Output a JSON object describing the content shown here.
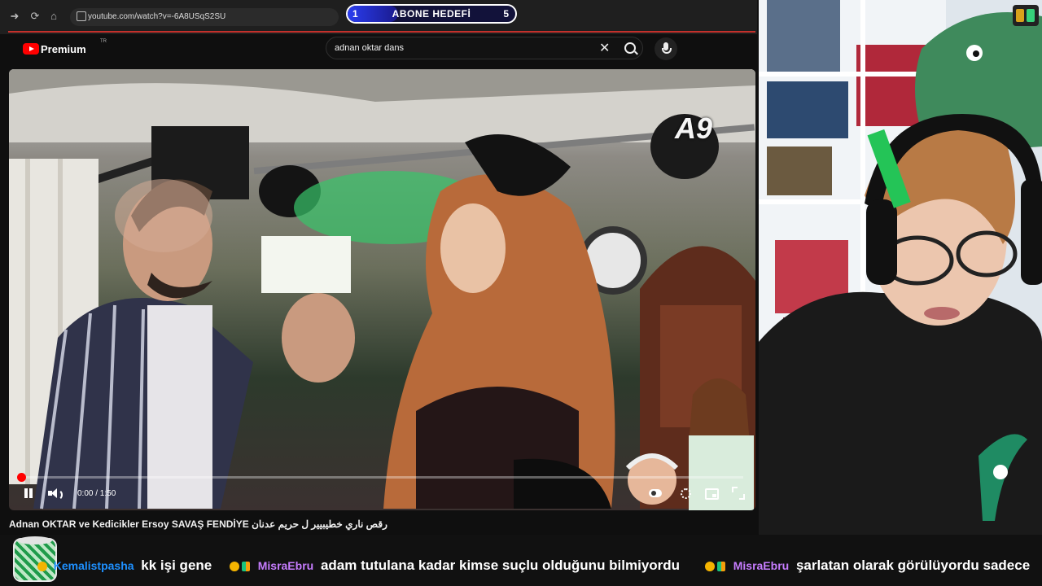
{
  "browser": {
    "url": "youtube.com/watch?v=-6A8USqS2SU",
    "nav_icons": [
      "arrow-forward-icon",
      "reload-icon",
      "home-icon",
      "site-settings-icon"
    ]
  },
  "goal_widget": {
    "title": "ABONE HEDEFİ",
    "min": "1",
    "max": "5",
    "progress_fraction": 0.1,
    "colors": {
      "fill": "#2a3df0",
      "background": "#12123a"
    }
  },
  "youtube": {
    "logo_text": "Premium",
    "logo_superscript": "TR",
    "search_query": "adnan oktar dans",
    "icons": [
      "clear-icon",
      "search-icon",
      "mic-icon"
    ],
    "brand_color": "#ff0000"
  },
  "player": {
    "watermark": "A9",
    "time_display": "0:00 / 1:50",
    "progress_fraction": 0.0,
    "video_title": "Adnan OKTAR ve Kedicikler Ersoy SAVAŞ FENDİYE رقص ناري خطيبيير ل حريم عدنان",
    "control_icons": [
      "pause-icon",
      "volume-icon",
      "autoplay-toggle-icon",
      "settings-icon",
      "miniplayer-icon",
      "fullscreen-icon"
    ]
  },
  "chat": {
    "messages": [
      {
        "user": "Kemalistpasha",
        "text": "kk işi gene",
        "user_color": "#1e90ff"
      },
      {
        "user": "MisraEbru",
        "text": "adam tutulana kadar kimse suçlu olduğunu bilmiyordu",
        "user_color": "#c77dff"
      },
      {
        "user": "MisraEbru",
        "text": "şarlatan olarak görülüyordu sadece",
        "user_color": "#c77dff"
      }
    ]
  }
}
